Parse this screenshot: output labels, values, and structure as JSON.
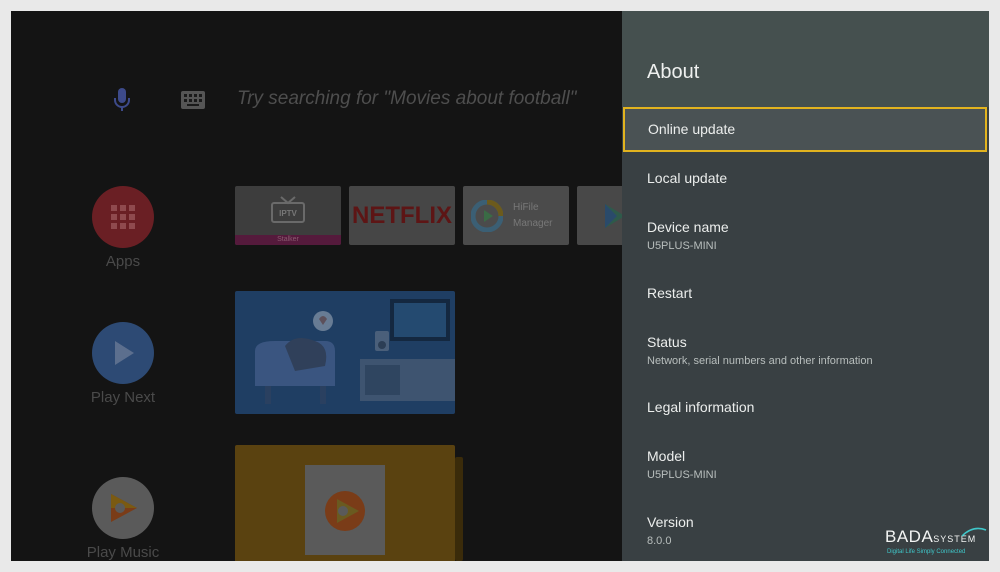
{
  "search": {
    "hint": "Try searching for \"Movies about football\"",
    "mic_icon": "mic-icon",
    "keyboard_icon": "keyboard-icon"
  },
  "rail": [
    {
      "label": "Apps",
      "icon": "apps-grid-icon",
      "color": "#6a1f24"
    },
    {
      "label": "Play Next",
      "icon": "play-icon",
      "color": "#2d4a74"
    },
    {
      "label": "Play Music",
      "icon": "play-music-icon",
      "color": "#5a5a5a"
    }
  ],
  "cards": {
    "iptv": {
      "badge": "IPTV",
      "strip": "Stalker"
    },
    "netflix": {
      "logo": "NETFLIX"
    },
    "hifile": {
      "line1": "HiFile",
      "line2": "Manager"
    }
  },
  "settings": {
    "title": "About",
    "items": [
      {
        "label": "Online update",
        "sub": ""
      },
      {
        "label": "Local update",
        "sub": ""
      },
      {
        "label": "Device name",
        "sub": "U5PLUS-MINI"
      },
      {
        "label": "Restart",
        "sub": ""
      },
      {
        "label": "Status",
        "sub": "Network, serial numbers and other information"
      },
      {
        "label": "Legal information",
        "sub": ""
      },
      {
        "label": "Model",
        "sub": "U5PLUS-MINI"
      },
      {
        "label": "Version",
        "sub": "8.0.0"
      }
    ]
  },
  "brand": {
    "name": "BADA",
    "name_suffix": "SYSTEM",
    "tagline": "Digital Life Simply Connected"
  },
  "colors": {
    "panel": "#394043",
    "panel_header": "#45504f",
    "focus_border": "#e2b31f",
    "accent_teal": "#3fc6c9"
  }
}
